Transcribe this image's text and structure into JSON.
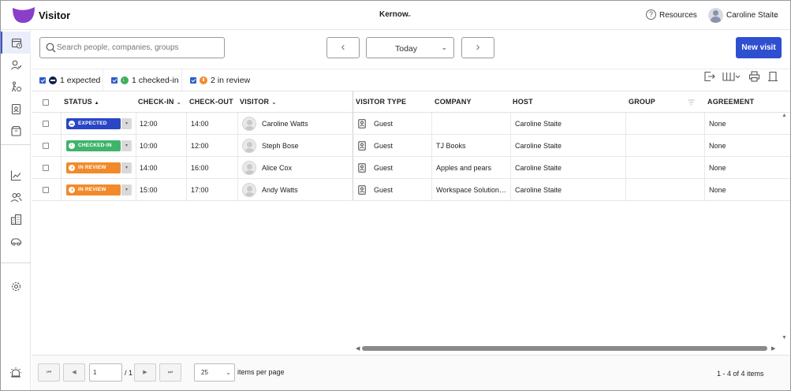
{
  "app": {
    "title": "Visitor",
    "brand_color": "#8a3fc9"
  },
  "header": {
    "org_label": "Kernow",
    "resources_label": "Resources",
    "user_name": "Caroline Staite"
  },
  "sidebar": {
    "items": [
      {
        "name": "visits-icon",
        "active": true
      },
      {
        "name": "person-check-icon",
        "active": false
      },
      {
        "name": "walking-icon",
        "active": false
      },
      {
        "name": "badge-icon",
        "active": false
      },
      {
        "name": "package-icon",
        "active": false
      },
      {
        "name": "analytics-icon",
        "active": false
      },
      {
        "name": "people-icon",
        "active": false
      },
      {
        "name": "building-icon",
        "active": false
      },
      {
        "name": "vehicle-icon",
        "active": false
      },
      {
        "name": "settings-icon",
        "active": false
      },
      {
        "name": "alarm-icon",
        "active": false
      }
    ]
  },
  "toolbar": {
    "search_placeholder": "Search people, companies, groups",
    "prev_label": "‹",
    "next_label": "›",
    "date_label": "Today",
    "new_visit_label": "New visit"
  },
  "filters": [
    {
      "label": "1 expected",
      "color": "#0e1e4f",
      "checked": true
    },
    {
      "label": "1 checked-in",
      "color": "#3fae5a",
      "checked": true
    },
    {
      "label": "2 in review",
      "color": "#f08c2a",
      "checked": true
    }
  ],
  "table": {
    "columns": [
      "STATUS",
      "CHECK-IN",
      "CHECK-OUT",
      "VISITOR",
      "VISITOR TYPE",
      "COMPANY",
      "HOST",
      "GROUP",
      "AGREEMENT"
    ],
    "sort_marks": {
      "status": "▲",
      "checkin": "⌄",
      "visitor": "⌄"
    },
    "rows": [
      {
        "status": "EXPECTED",
        "status_color": "#2a46c5",
        "checkin": "12:00",
        "checkout": "14:00",
        "visitor": "Caroline Watts",
        "type": "Guest",
        "company": "",
        "host": "Caroline Staite",
        "group": "",
        "agreement": "None"
      },
      {
        "status": "CHECKED-IN",
        "status_color": "#3fb46a",
        "checkin": "10:00",
        "checkout": "12:00",
        "visitor": "Steph Bose",
        "type": "Guest",
        "company": "TJ Books",
        "host": "Caroline Staite",
        "group": "",
        "agreement": "None"
      },
      {
        "status": "IN REVIEW",
        "status_color": "#f28a2b",
        "checkin": "14:00",
        "checkout": "16:00",
        "visitor": "Alice Cox",
        "type": "Guest",
        "company": "Apples and pears",
        "host": "Caroline Staite",
        "group": "",
        "agreement": "None"
      },
      {
        "status": "IN REVIEW",
        "status_color": "#f28a2b",
        "checkin": "15:00",
        "checkout": "17:00",
        "visitor": "Andy Watts",
        "type": "Guest",
        "company": "Workspace Solutions ...",
        "host": "Caroline Staite",
        "group": "",
        "agreement": "None"
      }
    ]
  },
  "pager": {
    "page": "1",
    "total_pages": "/ 1",
    "page_size": "25",
    "page_size_label": "items per page",
    "info": "1 - 4 of 4 items"
  }
}
